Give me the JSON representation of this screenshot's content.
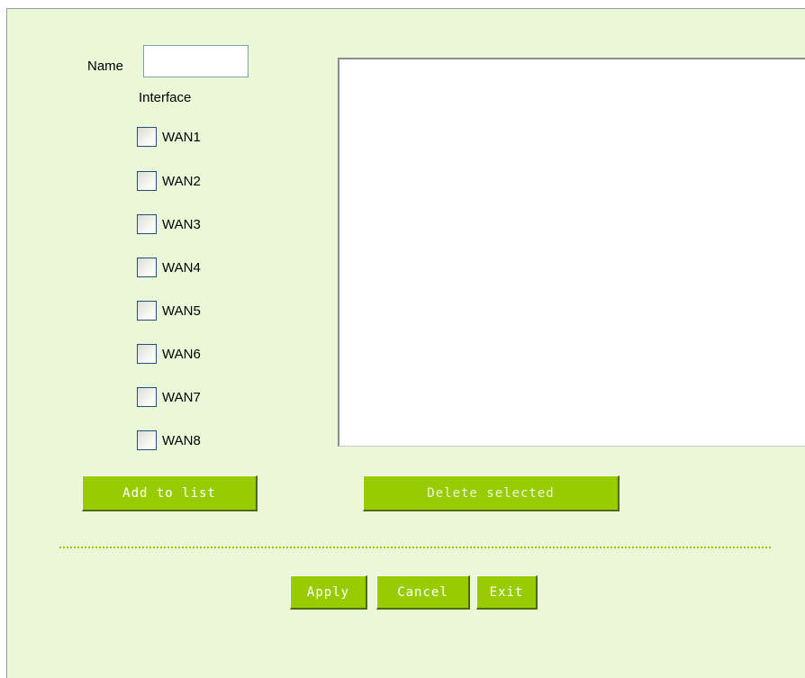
{
  "form": {
    "name_label": "Name",
    "name_value": "",
    "interface_label": "Interface"
  },
  "interfaces": [
    "WAN1",
    "WAN2",
    "WAN3",
    "WAN4",
    "WAN5",
    "WAN6",
    "WAN7",
    "WAN8"
  ],
  "list": {
    "items": []
  },
  "buttons": {
    "add_to_list": "Add to list",
    "delete_selected": "Delete selected",
    "apply": "Apply",
    "cancel": "Cancel",
    "exit": "Exit"
  },
  "colors": {
    "panel_bg": "#eaf8d8",
    "button_bg": "#99cc00",
    "button_text": "#ffffff",
    "divider": "#99cc00"
  }
}
